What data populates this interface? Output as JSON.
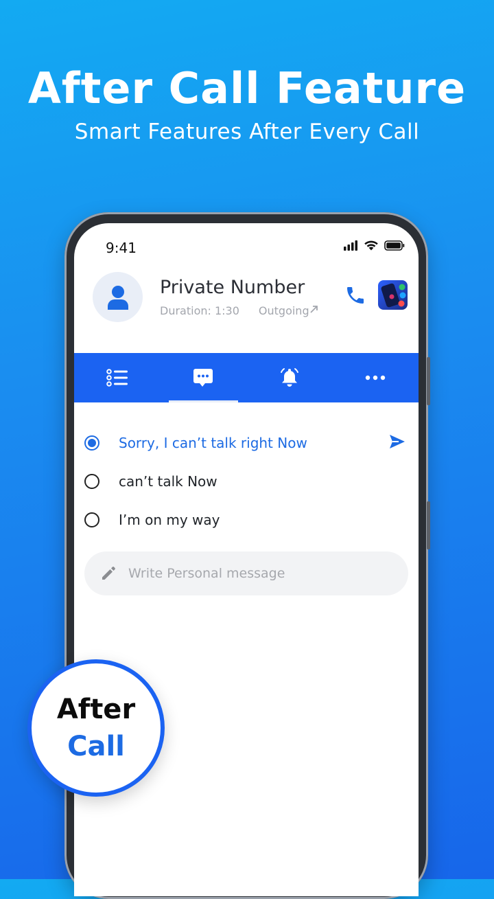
{
  "promo": {
    "title": "After Call Feature",
    "subtitle": "Smart Features After Every Call",
    "badge_line1": "After",
    "badge_line2": "Call"
  },
  "status_bar": {
    "time": "9:41",
    "icons": [
      "signal-icon",
      "wifi-icon",
      "battery-icon"
    ]
  },
  "call": {
    "contact_name": "Private Number",
    "duration": "Duration: 1:30",
    "direction": "Outgoing"
  },
  "tabs": [
    {
      "icon": "list-icon",
      "active": false
    },
    {
      "icon": "message-icon",
      "active": true
    },
    {
      "icon": "bell-icon",
      "active": false
    },
    {
      "icon": "more-icon",
      "active": false
    }
  ],
  "quick_replies": [
    {
      "text": "Sorry, I can’t talk right Now",
      "selected": true
    },
    {
      "text": "can’t talk Now",
      "selected": false
    },
    {
      "text": "I’m on my way",
      "selected": false
    }
  ],
  "message_input": {
    "placeholder": "Write Personal message",
    "value": ""
  },
  "colors": {
    "brand_blue": "#1b63f2",
    "accent_blue": "#1d6be3",
    "bg_top": "#13aaf2",
    "bg_bottom": "#1766ea"
  }
}
